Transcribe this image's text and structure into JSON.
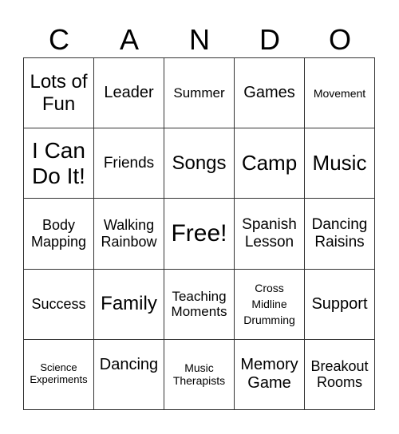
{
  "header": [
    "C",
    "A",
    "N",
    "D",
    "O"
  ],
  "cells": [
    [
      "Lots of Fun",
      "Leader",
      "Summer",
      "Games",
      "Movement"
    ],
    [
      "I Can Do It!",
      "Friends",
      "Songs",
      "Camp",
      "Music"
    ],
    [
      "Body Mapping",
      "Walking Rainbow",
      "Free!",
      "Spanish Lesson",
      "Dancing Raisins"
    ],
    [
      "Success",
      "Family",
      "Teaching Moments",
      "Cross Midline Drumming",
      "Support"
    ],
    [
      "Science Experiments",
      "Dancing",
      "Music Therapists",
      "Memory Game",
      "Breakout Rooms"
    ]
  ]
}
